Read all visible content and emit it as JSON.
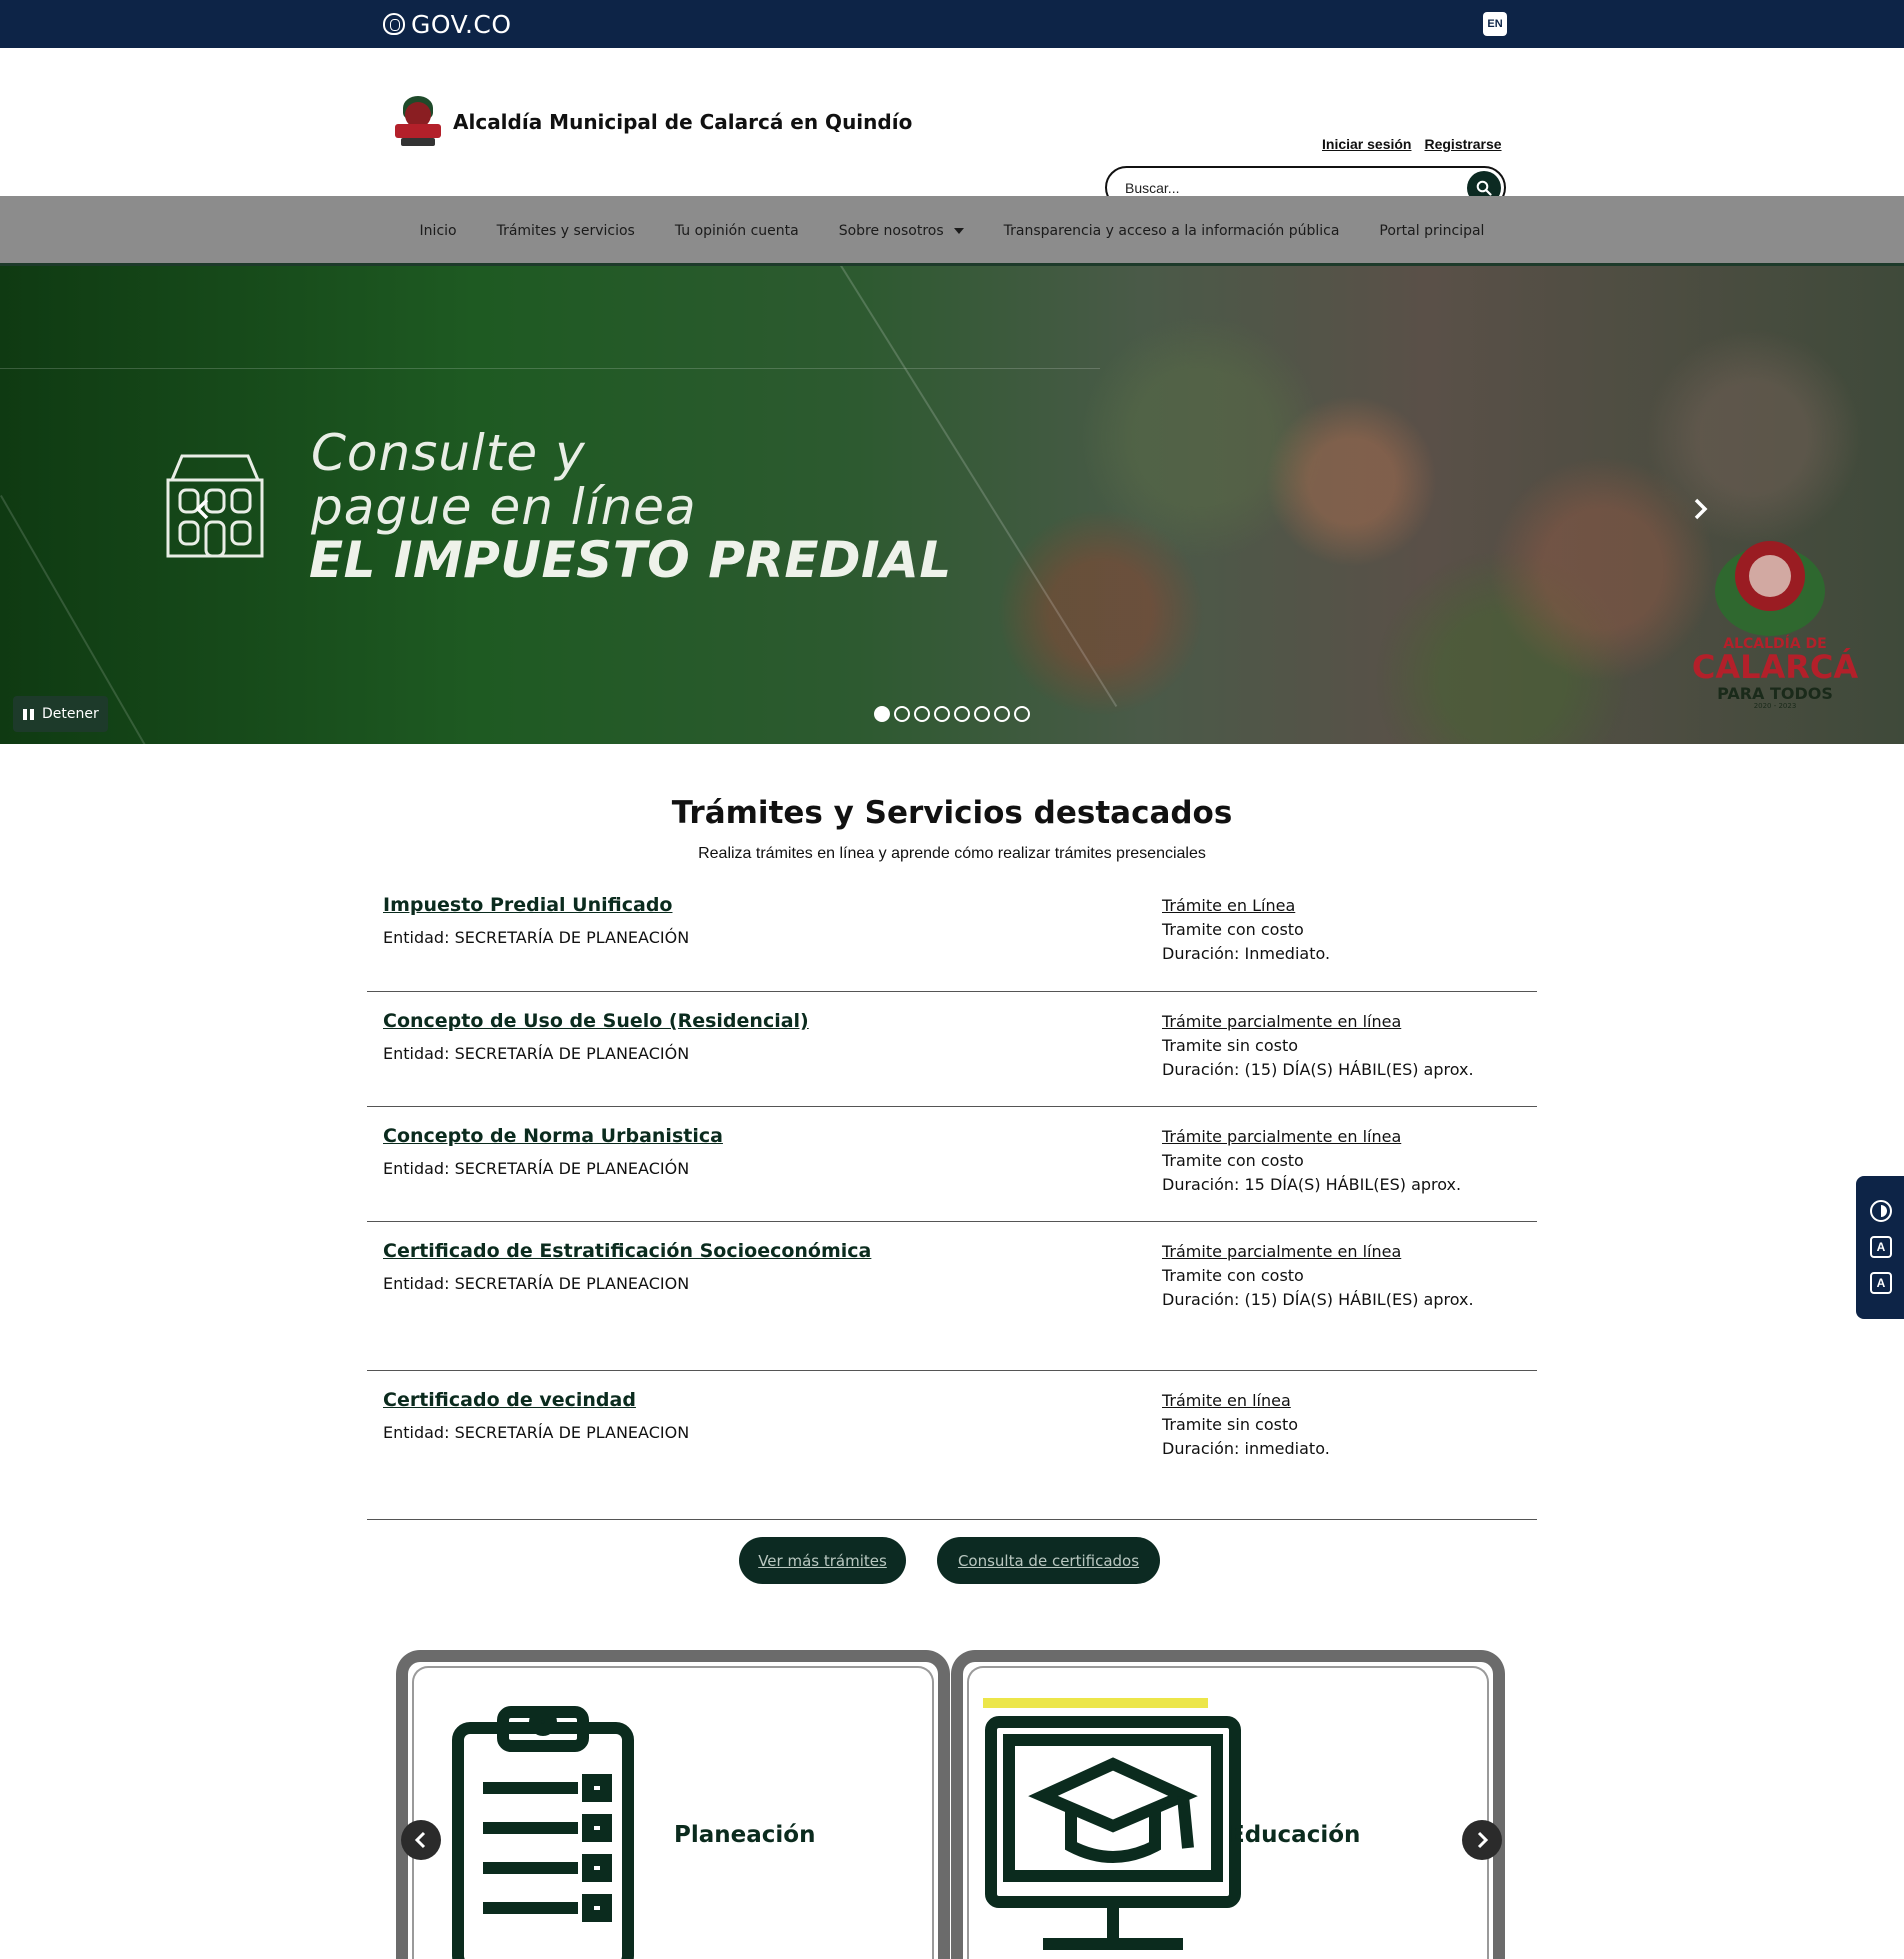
{
  "govbar": {
    "logo_text": "GOV.CO",
    "lang": "EN"
  },
  "header": {
    "site_name": "Alcaldía Municipal de Calarcá en Quindío",
    "login": "Iniciar sesión",
    "register": "Registrarse",
    "search_placeholder": "Buscar..."
  },
  "nav": {
    "items": [
      {
        "label": "Inicio"
      },
      {
        "label": "Trámites y servicios"
      },
      {
        "label": "Tu opinión cuenta"
      },
      {
        "label": "Sobre nosotros"
      },
      {
        "label": "Transparencia y acceso a la información pública"
      },
      {
        "label": "Portal principal"
      }
    ]
  },
  "hero": {
    "line1": "Consulte y",
    "line2": "pague en línea",
    "line3": "EL IMPUESTO PREDIAL",
    "seal_small": "ALCALDÍA DE",
    "seal_big": "CALARCÁ",
    "seal_motto": "PARA TODOS",
    "seal_years": "2020 - 2023",
    "pause_label": "Detener",
    "slide_count": 8,
    "active_slide": 1
  },
  "featured": {
    "title": "Trámites y Servicios destacados",
    "subtitle": "Realiza trámites en línea y aprende cómo realizar trámites presenciales",
    "items": [
      {
        "name": "Impuesto Predial Unificado",
        "entity": "Entidad: SECRETARÍA DE PLANEACIÓN",
        "mode": "Trámite en Línea",
        "cost": "Tramite con costo",
        "duration": "Duración: Inmediato."
      },
      {
        "name": "Concepto de Uso de Suelo (Residencial)",
        "entity": "Entidad: SECRETARÍA DE PLANEACIÓN",
        "mode": "Trámite parcialmente en línea",
        "cost": "Tramite sin costo",
        "duration": "Duración: (15) DÍA(S) HÁBIL(ES) aprox."
      },
      {
        "name": "Concepto de Norma Urbanistica",
        "entity": "Entidad: SECRETARÍA DE PLANEACIÓN",
        "mode": "Trámite parcialmente en línea",
        "cost": "Tramite con costo",
        "duration": "Duración: 15 DÍA(S) HÁBIL(ES) aprox."
      },
      {
        "name": "Certificado de Estratificación Socioeconómica",
        "entity": "Entidad: SECRETARÍA DE PLANEACION",
        "mode": "Trámite parcialmente en línea",
        "cost": "Tramite con costo",
        "duration": "Duración: (15) DÍA(S) HÁBIL(ES) aprox."
      },
      {
        "name": "Certificado de vecindad",
        "entity": "Entidad: SECRETARÍA DE PLANEACION",
        "mode": "Trámite en línea",
        "cost": "Tramite sin costo",
        "duration": "Duración: inmediato."
      }
    ],
    "more_button": "Ver más trámites",
    "certificates_button": "Consulta de certificados"
  },
  "categories": [
    {
      "label": "Planeación",
      "icon": "clipboard-icon"
    },
    {
      "label": "Educación",
      "icon": "graduation-cap-icon"
    }
  ],
  "colors": {
    "govbar": "#0d2447",
    "accent_dark_green": "#0c2a22",
    "nav_bg": "#8c8c8c"
  }
}
